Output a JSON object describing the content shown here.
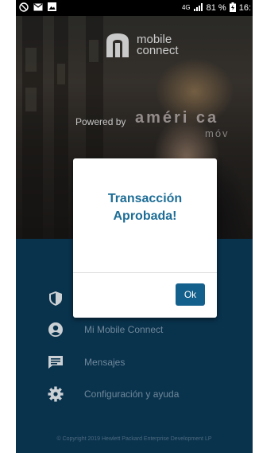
{
  "status_bar": {
    "network": "4G",
    "battery": "81 %",
    "time": "16:"
  },
  "hero": {
    "logo_line1": "mobile",
    "logo_line2": "connect",
    "powered_by": "Powered by",
    "brand1": "améri ca",
    "brand2": "móv"
  },
  "dialog": {
    "title_line1": "Transacción",
    "title_line2": "Aprobada!",
    "ok_label": "Ok"
  },
  "menu": {
    "items": [
      {
        "label": "",
        "icon": "shield-icon"
      },
      {
        "label": "Mi Mobile Connect",
        "icon": "account-icon"
      },
      {
        "label": "Mensajes",
        "icon": "message-icon"
      },
      {
        "label": "Configuración y ayuda",
        "icon": "gear-icon"
      }
    ]
  },
  "footer": {
    "copyright": "© Copyright 2019 Hewlett Packard Enterprise Development LP"
  },
  "colors": {
    "accent": "#1d6d96",
    "button": "#14608c",
    "menu_bg": "#0b3a57"
  }
}
